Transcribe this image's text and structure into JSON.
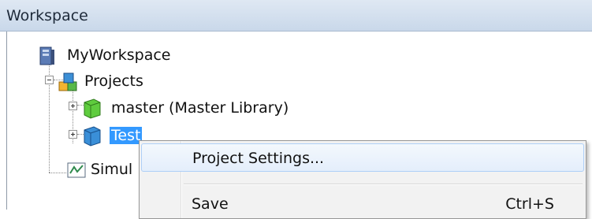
{
  "panel": {
    "title": "Workspace"
  },
  "tree": {
    "workspace": {
      "label": "MyWorkspace",
      "icon": "workspace-icon"
    },
    "projects": {
      "label": "Projects",
      "icon": "projects-icon"
    },
    "master": {
      "label": "master (Master Library)",
      "icon": "library-icon"
    },
    "test": {
      "label": "Test",
      "icon": "project-icon"
    },
    "simulation": {
      "label": "Simul",
      "icon": "simulation-icon"
    }
  },
  "context_menu": {
    "items": [
      {
        "label": "Project Settings...",
        "shortcut": ""
      },
      {
        "label": "Save",
        "shortcut": "Ctrl+S"
      }
    ]
  },
  "colors": {
    "selection": "#3399ff",
    "titlebar": "#d3dfee",
    "menu_background": "#f2f2f2"
  }
}
